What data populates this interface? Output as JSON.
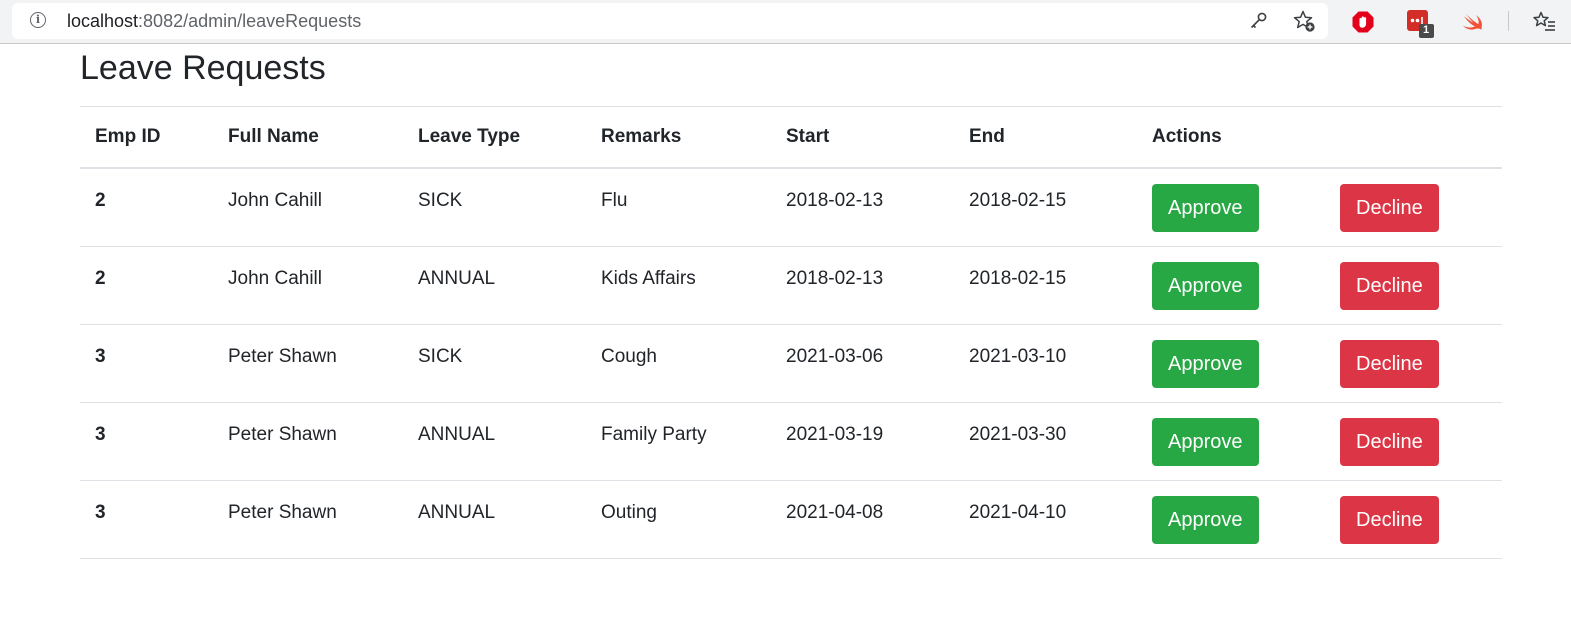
{
  "browser": {
    "url_host": "localhost",
    "url_path": ":8082/admin/leaveRequests",
    "extension_badge": "1"
  },
  "page": {
    "title": "Leave Requests"
  },
  "table": {
    "headers": {
      "emp_id": "Emp ID",
      "full_name": "Full Name",
      "leave_type": "Leave Type",
      "remarks": "Remarks",
      "start": "Start",
      "end": "End",
      "actions": "Actions"
    },
    "approve_label": "Approve",
    "decline_label": "Decline",
    "rows": [
      {
        "emp_id": "2",
        "full_name": "John Cahill",
        "leave_type": "SICK",
        "remarks": "Flu",
        "start": "2018-02-13",
        "end": "2018-02-15"
      },
      {
        "emp_id": "2",
        "full_name": "John Cahill",
        "leave_type": "ANNUAL",
        "remarks": "Kids Affairs",
        "start": "2018-02-13",
        "end": "2018-02-15"
      },
      {
        "emp_id": "3",
        "full_name": "Peter Shawn",
        "leave_type": "SICK",
        "remarks": "Cough",
        "start": "2021-03-06",
        "end": "2021-03-10"
      },
      {
        "emp_id": "3",
        "full_name": "Peter Shawn",
        "leave_type": "ANNUAL",
        "remarks": "Family Party",
        "start": "2021-03-19",
        "end": "2021-03-30"
      },
      {
        "emp_id": "3",
        "full_name": "Peter Shawn",
        "leave_type": "ANNUAL",
        "remarks": "Outing",
        "start": "2021-04-08",
        "end": "2021-04-10"
      }
    ]
  },
  "colors": {
    "approve": "#28a745",
    "decline": "#dc3545",
    "border": "#dee2e6",
    "text": "#212529"
  },
  "icons": {
    "page_info": "info-icon",
    "key": "key-icon",
    "bookmark": "star-add-icon",
    "extension_1": "adblock-icon",
    "extension_2": "lastpass-icon",
    "extension_3": "swift-icon",
    "reading_list": "reading-list-icon"
  }
}
